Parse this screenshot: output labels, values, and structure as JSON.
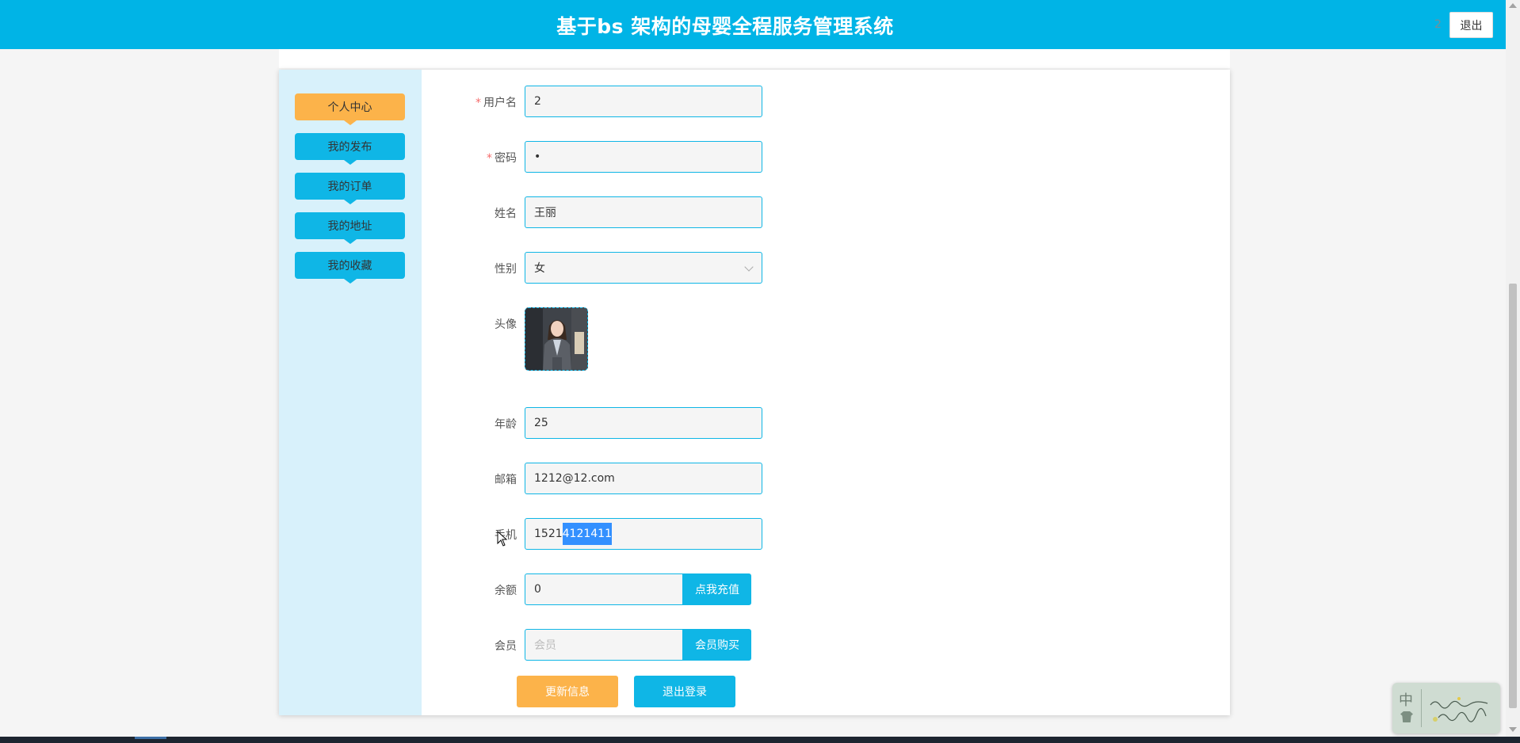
{
  "header": {
    "title": "基于bs 架构的母婴全程服务管理系统",
    "user": "2",
    "logout_label": "退出"
  },
  "sidebar": {
    "items": [
      {
        "label": "个人中心",
        "active": true
      },
      {
        "label": "我的发布",
        "active": false
      },
      {
        "label": "我的订单",
        "active": false
      },
      {
        "label": "我的地址",
        "active": false
      },
      {
        "label": "我的收藏",
        "active": false
      }
    ]
  },
  "form": {
    "username": {
      "label": "用户名",
      "value": "2"
    },
    "password": {
      "label": "密码",
      "value": "•"
    },
    "name": {
      "label": "姓名",
      "value": "王丽"
    },
    "gender": {
      "label": "性别",
      "value": "女"
    },
    "avatar": {
      "label": "头像"
    },
    "age": {
      "label": "年龄",
      "value": "25"
    },
    "email": {
      "label": "邮箱",
      "value": "1212@12.com"
    },
    "phone": {
      "label": "手机",
      "value_plain": "1521",
      "value_selected": "4121411"
    },
    "balance": {
      "label": "余额",
      "value": "0",
      "button": "点我充值"
    },
    "member": {
      "label": "会员",
      "placeholder": "会员",
      "button": "会员购买"
    }
  },
  "actions": {
    "update_label": "更新信息",
    "logout_label": "退出登录"
  },
  "ime": {
    "char": "中"
  },
  "colors": {
    "primary": "#00b4e6",
    "accent": "#fcb34a",
    "sidebar_bg": "#d8f1fb"
  }
}
